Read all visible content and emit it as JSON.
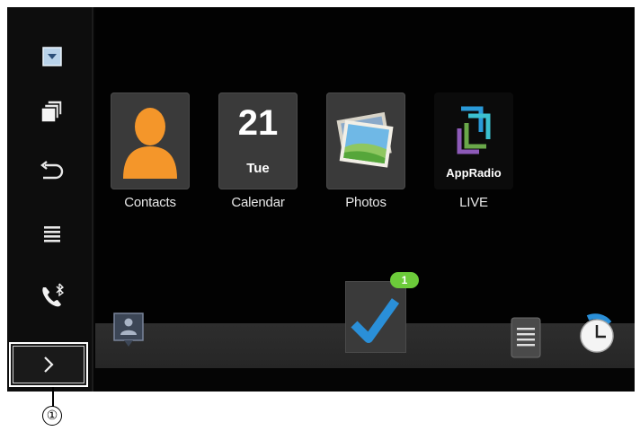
{
  "apps": [
    {
      "label": "Contacts",
      "icon": "contacts-icon"
    },
    {
      "label": "Calendar",
      "icon": "calendar-icon",
      "day": "21",
      "weekday": "Tue"
    },
    {
      "label": "Photos",
      "icon": "photos-icon"
    },
    {
      "label": "LIVE",
      "icon": "appradio-icon",
      "tile_text": "AppRadio"
    }
  ],
  "sidebar": {
    "items": [
      "dropdown-icon",
      "multitask-icon",
      "back-icon",
      "menu-icon",
      "bluetooth-phone-icon"
    ],
    "expand_button": "chevron-right-icon"
  },
  "dock": {
    "items": [
      "contact-card-icon",
      "task-check-icon",
      "notes-icon",
      "clock-icon"
    ],
    "badge": "1"
  },
  "callout": "①",
  "colors": {
    "accent_orange": "#f4962a",
    "check_blue": "#2a8fd8",
    "badge_green": "#6ccb3a"
  }
}
